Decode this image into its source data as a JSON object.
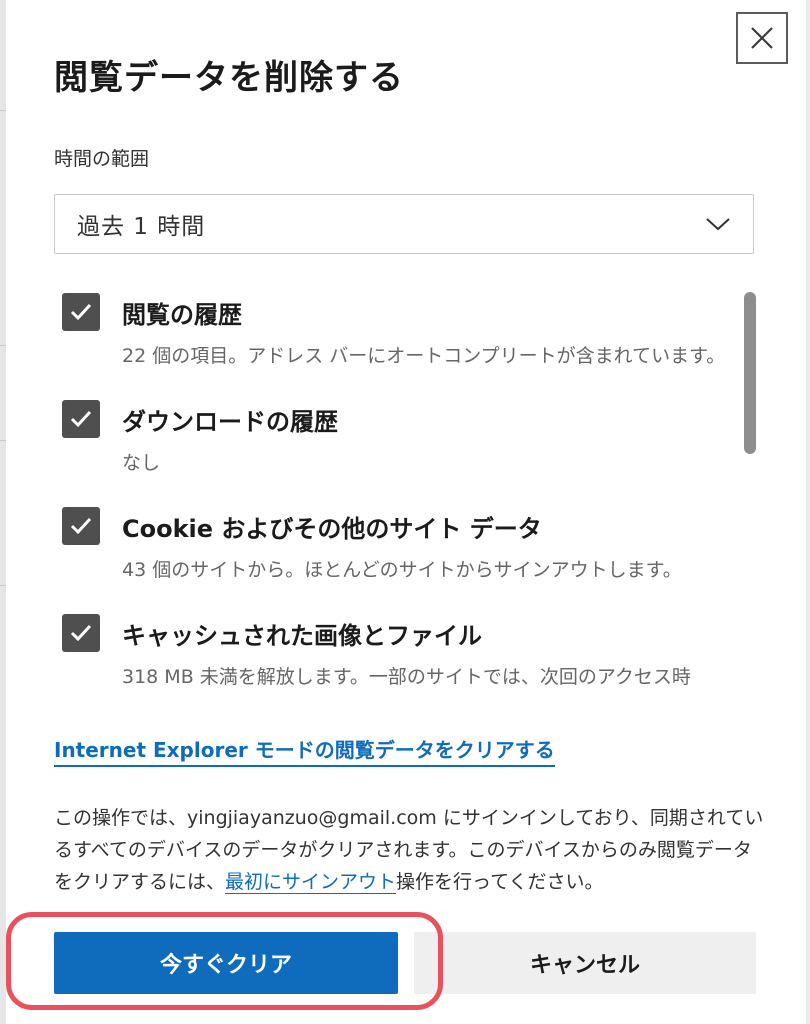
{
  "dialog": {
    "title": "閲覧データを削除する",
    "close_icon": "close-icon"
  },
  "time_range": {
    "label": "時間の範囲",
    "selected": "過去 1 時間",
    "icon": "chevron-down-icon"
  },
  "items": [
    {
      "title": "閲覧の履歴",
      "description": "22 個の項目。アドレス バーにオートコンプリートが含まれています。",
      "checked": true
    },
    {
      "title": "ダウンロードの履歴",
      "description": "なし",
      "checked": true
    },
    {
      "title": "Cookie およびその他のサイト データ",
      "description": "43 個のサイトから。ほとんどのサイトからサインアウトします。",
      "checked": true
    },
    {
      "title": "キャッシュされた画像とファイル",
      "description": "318 MB 未満を解放します。一部のサイトでは、次回のアクセス時",
      "checked": true
    }
  ],
  "ie_link": "Internet Explorer モードの閲覧データをクリアする",
  "notice": {
    "text_before": "この操作では、yingjiayanzuo@gmail.com にサインインしており、同期されているすべてのデバイスのデータがクリアされます。このデバイスからのみ閲覧データをクリアするには、",
    "link": "最初にサインアウト",
    "text_after": "操作を行ってください。"
  },
  "buttons": {
    "clear_now": "今すぐクリア",
    "cancel": "キャンセル"
  },
  "colors": {
    "accent": "#0f6cbd",
    "highlight": "#e8525d",
    "checkbox": "#4f4f4f"
  }
}
